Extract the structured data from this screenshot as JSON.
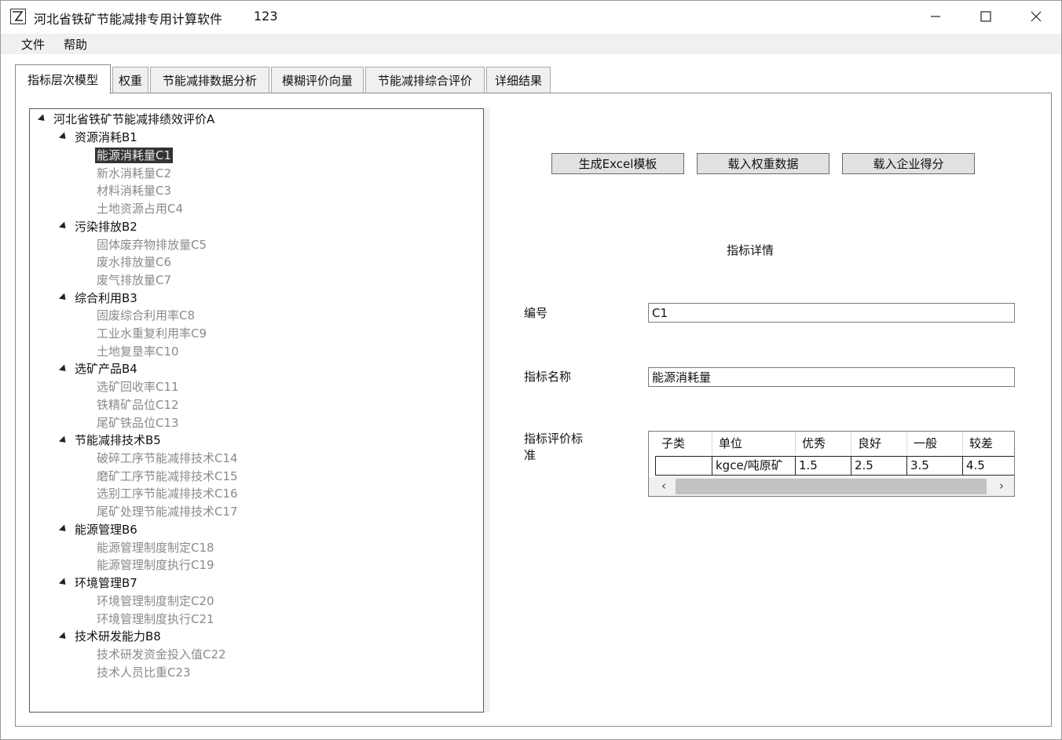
{
  "window": {
    "title": "河北省铁矿节能减排专用计算软件",
    "title_extra": "123"
  },
  "menu": {
    "file": "文件",
    "help": "帮助"
  },
  "tabs": [
    {
      "label": "指标层次模型",
      "active": true
    },
    {
      "label": "权重",
      "active": false
    },
    {
      "label": "节能减排数据分析",
      "active": false
    },
    {
      "label": "模糊评价向量",
      "active": false
    },
    {
      "label": "节能减排综合评价",
      "active": false
    },
    {
      "label": "详细结果",
      "active": false
    }
  ],
  "tree": {
    "root": "河北省铁矿节能减排绩效评价A",
    "groups": [
      {
        "label": "资源消耗B1",
        "children": [
          "能源消耗量C1",
          "新水消耗量C2",
          "材料消耗量C3",
          "土地资源占用C4"
        ]
      },
      {
        "label": "污染排放B2",
        "children": [
          "固体废弃物排放量C5",
          "废水排放量C6",
          "废气排放量C7"
        ]
      },
      {
        "label": "综合利用B3",
        "children": [
          "固废综合利用率C8",
          "工业水重复利用率C9",
          "土地复垦率C10"
        ]
      },
      {
        "label": "选矿产品B4",
        "children": [
          "选矿回收率C11",
          "铁精矿品位C12",
          "尾矿铁品位C13"
        ]
      },
      {
        "label": "节能减排技术B5",
        "children": [
          "破碎工序节能减排技术C14",
          "磨矿工序节能减排技术C15",
          "选别工序节能减排技术C16",
          "尾矿处理节能减排技术C17"
        ]
      },
      {
        "label": "能源管理B6",
        "children": [
          "能源管理制度制定C18",
          "能源管理制度执行C19"
        ]
      },
      {
        "label": "环境管理B7",
        "children": [
          "环境管理制度制定C20",
          "环境管理制度执行C21"
        ]
      },
      {
        "label": "技术研发能力B8",
        "children": [
          "技术研发资金投入值C22",
          "技术人员比重C23"
        ]
      }
    ],
    "selected": "能源消耗量C1"
  },
  "actions": {
    "gen_excel": "生成Excel模板",
    "load_weights": "载入权重数据",
    "load_scores": "载入企业得分"
  },
  "details": {
    "title": "指标详情",
    "code_label": "编号",
    "code_value": "C1",
    "name_label": "指标名称",
    "name_value": "能源消耗量",
    "criteria_label_1": "指标评价标",
    "criteria_label_2": "准"
  },
  "grid": {
    "headers": [
      "子类",
      "单位",
      "优秀",
      "良好",
      "一般",
      "较差"
    ],
    "rows": [
      [
        "",
        "kgce/吨原矿",
        "1.5",
        "2.5",
        "3.5",
        "4.5"
      ]
    ]
  },
  "scroll": {
    "left": "‹",
    "right": "›"
  }
}
